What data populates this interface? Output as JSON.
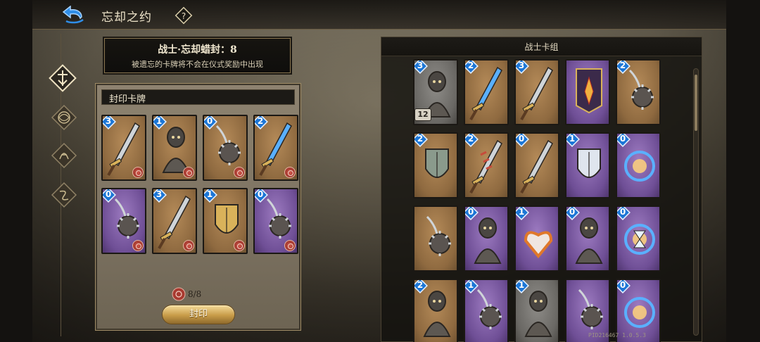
{
  "header": {
    "title": "忘却之约",
    "back_icon": "back-arrow-icon",
    "help_icon": "help-diamond-icon"
  },
  "nav": [
    {
      "name": "warrior",
      "icon": "warrior-emblem-icon",
      "active": true
    },
    {
      "name": "class-2",
      "icon": "beast-emblem-icon",
      "active": false
    },
    {
      "name": "class-3",
      "icon": "rune-emblem-icon",
      "active": false
    },
    {
      "name": "class-4",
      "icon": "sigil-emblem-icon",
      "active": false
    }
  ],
  "banner": {
    "title": "战士·忘却蜡封：8",
    "subtitle": "被遗忘的卡牌将不会在仪式奖励中出现"
  },
  "sealed_panel": {
    "header": "封印卡牌",
    "counter": "8/8",
    "counter_icon": "wax-seal-icon",
    "button_label": "封印",
    "cards": [
      {
        "cost": "3",
        "frame": "tan",
        "art": "halberd-icon"
      },
      {
        "cost": "1",
        "frame": "tan",
        "art": "sling-pouch-icon"
      },
      {
        "cost": "0",
        "frame": "tan",
        "art": "spiked-club-icon"
      },
      {
        "cost": "2",
        "frame": "tan",
        "art": "glowing-sword-icon"
      },
      {
        "cost": "0",
        "frame": "purple",
        "art": "spiked-gauntlet-icon"
      },
      {
        "cost": "3",
        "frame": "tan",
        "art": "longsword-icon"
      },
      {
        "cost": "1",
        "frame": "tan",
        "art": "golden-shield-icon"
      },
      {
        "cost": "0",
        "frame": "purple",
        "art": "armored-fist-icon"
      }
    ]
  },
  "deck_panel": {
    "header": "战士卡组",
    "cards": [
      {
        "cost": "3",
        "frame": "grey",
        "art": "armor-statue-icon",
        "count": "12"
      },
      {
        "cost": "2",
        "frame": "tan",
        "art": "curved-blade-icon"
      },
      {
        "cost": "3",
        "frame": "tan",
        "art": "broad-sword-icon"
      },
      {
        "cost": "",
        "frame": "purple",
        "art": "war-banner-icon"
      },
      {
        "cost": "2",
        "frame": "tan",
        "art": "flail-icon"
      },
      {
        "cost": "2",
        "frame": "tan",
        "art": "axe-shield-icon"
      },
      {
        "cost": "2",
        "frame": "tan",
        "art": "serrated-blade-icon"
      },
      {
        "cost": "0",
        "frame": "tan",
        "art": "dagger-icon"
      },
      {
        "cost": "1",
        "frame": "purple",
        "art": "crystal-shield-icon"
      },
      {
        "cost": "0",
        "frame": "purple",
        "art": "rune-orb-icon"
      },
      {
        "cost": "",
        "frame": "tan",
        "art": "claw-gauntlet-icon"
      },
      {
        "cost": "0",
        "frame": "purple",
        "art": "armored-knight-icon"
      },
      {
        "cost": "1",
        "frame": "purple",
        "art": "flaming-heart-icon"
      },
      {
        "cost": "0",
        "frame": "purple",
        "art": "siege-engine-icon"
      },
      {
        "cost": "0",
        "frame": "purple",
        "art": "hourglass-icon"
      },
      {
        "cost": "2",
        "frame": "tan",
        "art": "skeletal-arm-icon"
      },
      {
        "cost": "1",
        "frame": "purple",
        "art": "shadow-fist-icon"
      },
      {
        "cost": "1",
        "frame": "grey",
        "art": "hooded-figure-icon"
      },
      {
        "cost": "",
        "frame": "purple",
        "art": "gilded-gauntlet-icon"
      },
      {
        "cost": "0",
        "frame": "purple",
        "art": "spark-strike-icon"
      }
    ]
  },
  "footer": {
    "version": "PID216467 1.0.5.3"
  },
  "colors": {
    "cost_badge": "#1c76d6",
    "tan_frame": "#8f6a40",
    "purple_frame": "#6f4f96",
    "button_gold": "#c79b48"
  }
}
